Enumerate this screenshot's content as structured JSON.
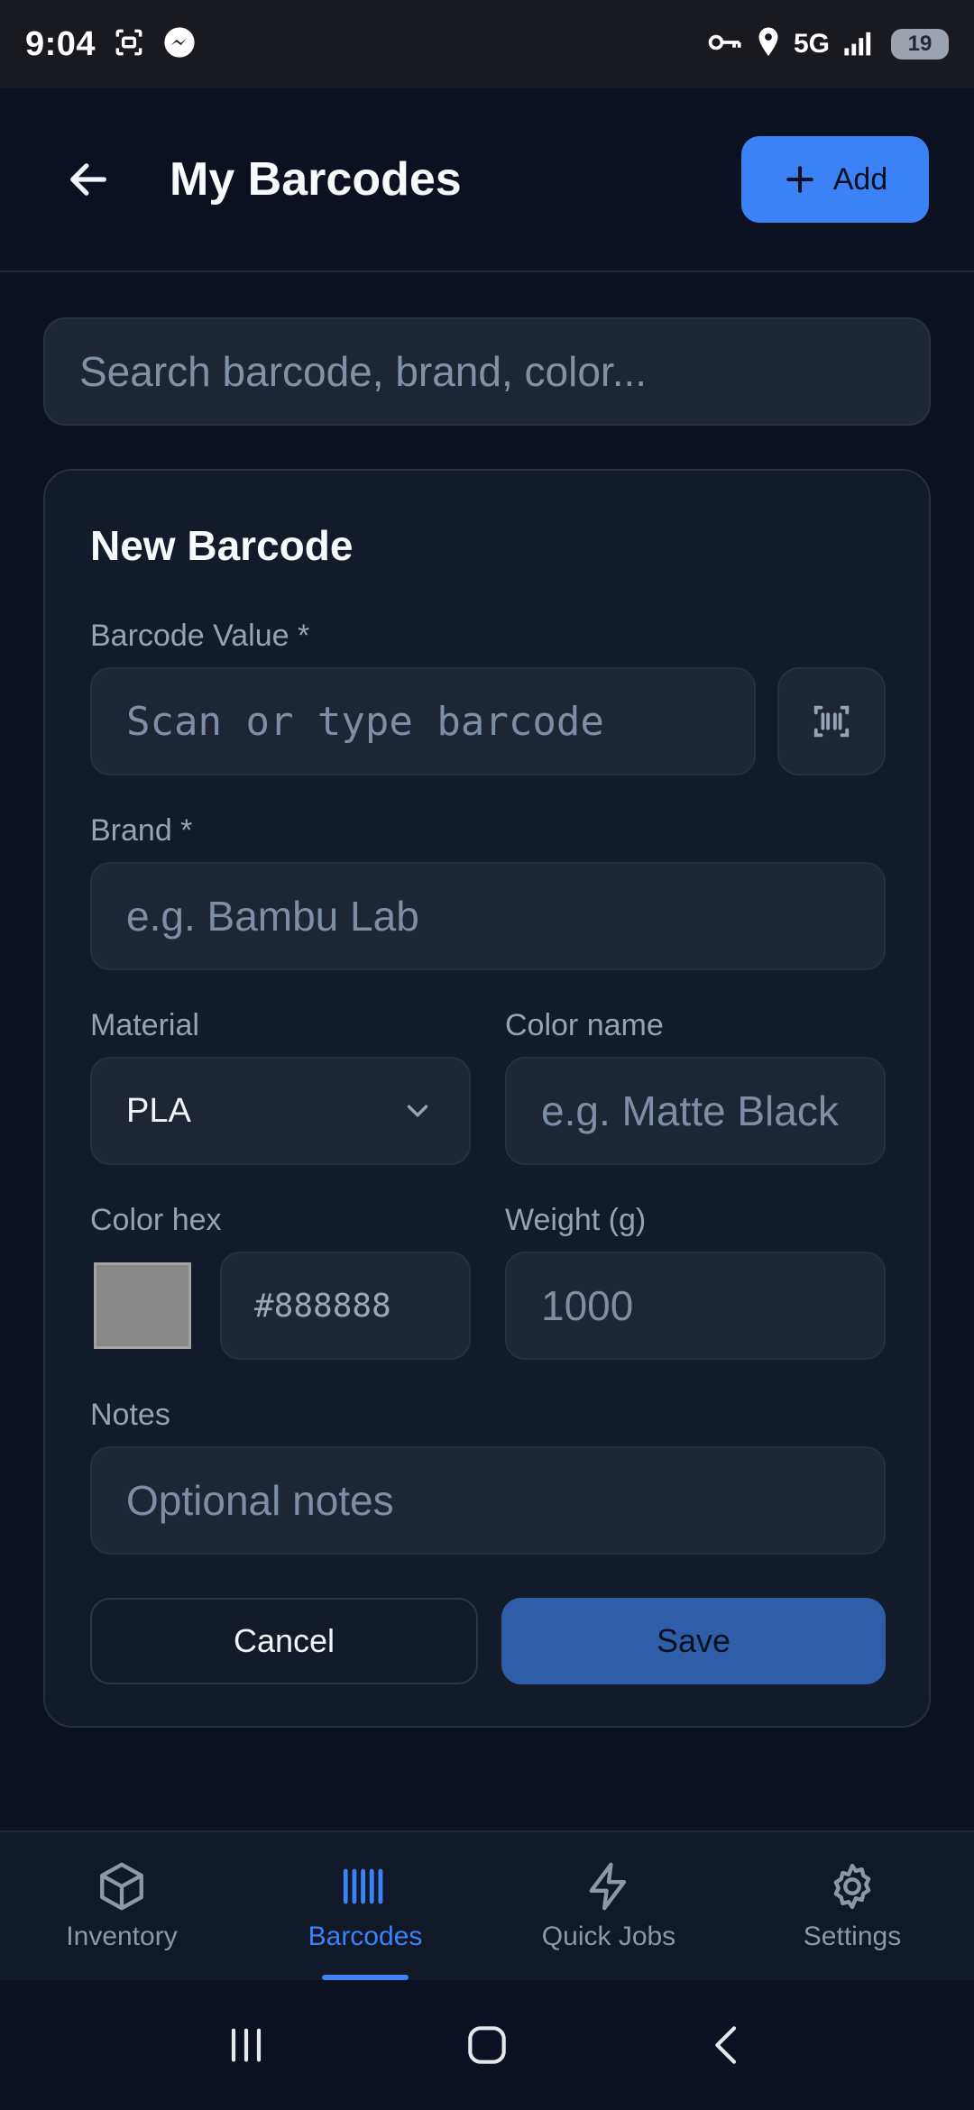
{
  "status_bar": {
    "time": "9:04",
    "network": "5G",
    "battery": "19"
  },
  "header": {
    "title": "My Barcodes",
    "add_label": "Add"
  },
  "search": {
    "placeholder": "Search barcode, brand, color..."
  },
  "form": {
    "title": "New Barcode",
    "barcode_label": "Barcode Value *",
    "barcode_placeholder": "Scan or type barcode",
    "brand_label": "Brand *",
    "brand_placeholder": "e.g. Bambu Lab",
    "material_label": "Material",
    "material_value": "PLA",
    "color_name_label": "Color name",
    "color_name_placeholder": "e.g. Matte Black",
    "color_hex_label": "Color hex",
    "color_hex_value": "#888888",
    "swatch_color": "#888888",
    "weight_label": "Weight (g)",
    "weight_placeholder": "1000",
    "notes_label": "Notes",
    "notes_placeholder": "Optional notes",
    "cancel_label": "Cancel",
    "save_label": "Save"
  },
  "bottom_nav": {
    "items": [
      {
        "label": "Inventory",
        "icon": "package-icon",
        "active": false
      },
      {
        "label": "Barcodes",
        "icon": "barcode-icon",
        "active": true
      },
      {
        "label": "Quick Jobs",
        "icon": "lightning-icon",
        "active": false
      },
      {
        "label": "Settings",
        "icon": "gear-icon",
        "active": false
      }
    ]
  },
  "colors": {
    "accent": "#3b82f6",
    "background": "#0b1120",
    "card": "#131b2b",
    "field": "#1e2636"
  }
}
